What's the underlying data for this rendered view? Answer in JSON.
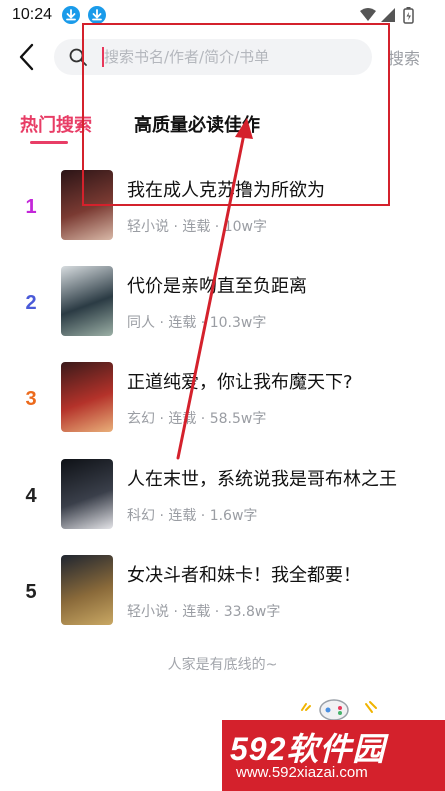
{
  "status_bar": {
    "time": "10:24"
  },
  "search": {
    "placeholder": "搜索书名/作者/简介/书单",
    "value": "",
    "button_label": "搜索"
  },
  "tabs": [
    {
      "label": "热门搜索",
      "active": true
    },
    {
      "label": "高质量必读佳作",
      "active": false
    }
  ],
  "books": [
    {
      "rank": "1",
      "rank_color": "#c327d9",
      "title": "我在成人克苏撸为所欲为",
      "meta": "轻小说 · 连载 · 10w字",
      "cover_colors": [
        "#2b1416",
        "#7a3a32",
        "#d9b9a8"
      ]
    },
    {
      "rank": "2",
      "rank_color": "#4a5ad8",
      "title": "代价是亲吻直至负距离",
      "meta": "同人 · 连载 · 10.3w字",
      "cover_colors": [
        "#d8dde0",
        "#2b3b44",
        "#9cb0a6"
      ]
    },
    {
      "rank": "3",
      "rank_color": "#ec6a1c",
      "title": "正道纯爱，你让我布魔天下?",
      "meta": "玄幻 · 连载 · 58.5w字",
      "cover_colors": [
        "#3a1a1a",
        "#b4322a",
        "#e9b07a"
      ]
    },
    {
      "rank": "4",
      "rank_color": "#222222",
      "title": "人在末世，系统说我是哥布林之王",
      "meta": "科幻 · 连载 · 1.6w字",
      "cover_colors": [
        "#0e1116",
        "#3a3f4a",
        "#e4e4e8"
      ]
    },
    {
      "rank": "5",
      "rank_color": "#222222",
      "title": "女决斗者和妹卡！我全都要！",
      "meta": "轻小说 · 连载 · 33.8w字",
      "cover_colors": [
        "#1f2530",
        "#8a6a3a",
        "#c9a864"
      ]
    }
  ],
  "footer": {
    "text": "人家是有底线的~"
  },
  "watermark": {
    "logo": "592软件园",
    "url": "www.592xiazai.com"
  },
  "colors": {
    "accent": "#e83d66",
    "annotation": "#d4212c"
  }
}
